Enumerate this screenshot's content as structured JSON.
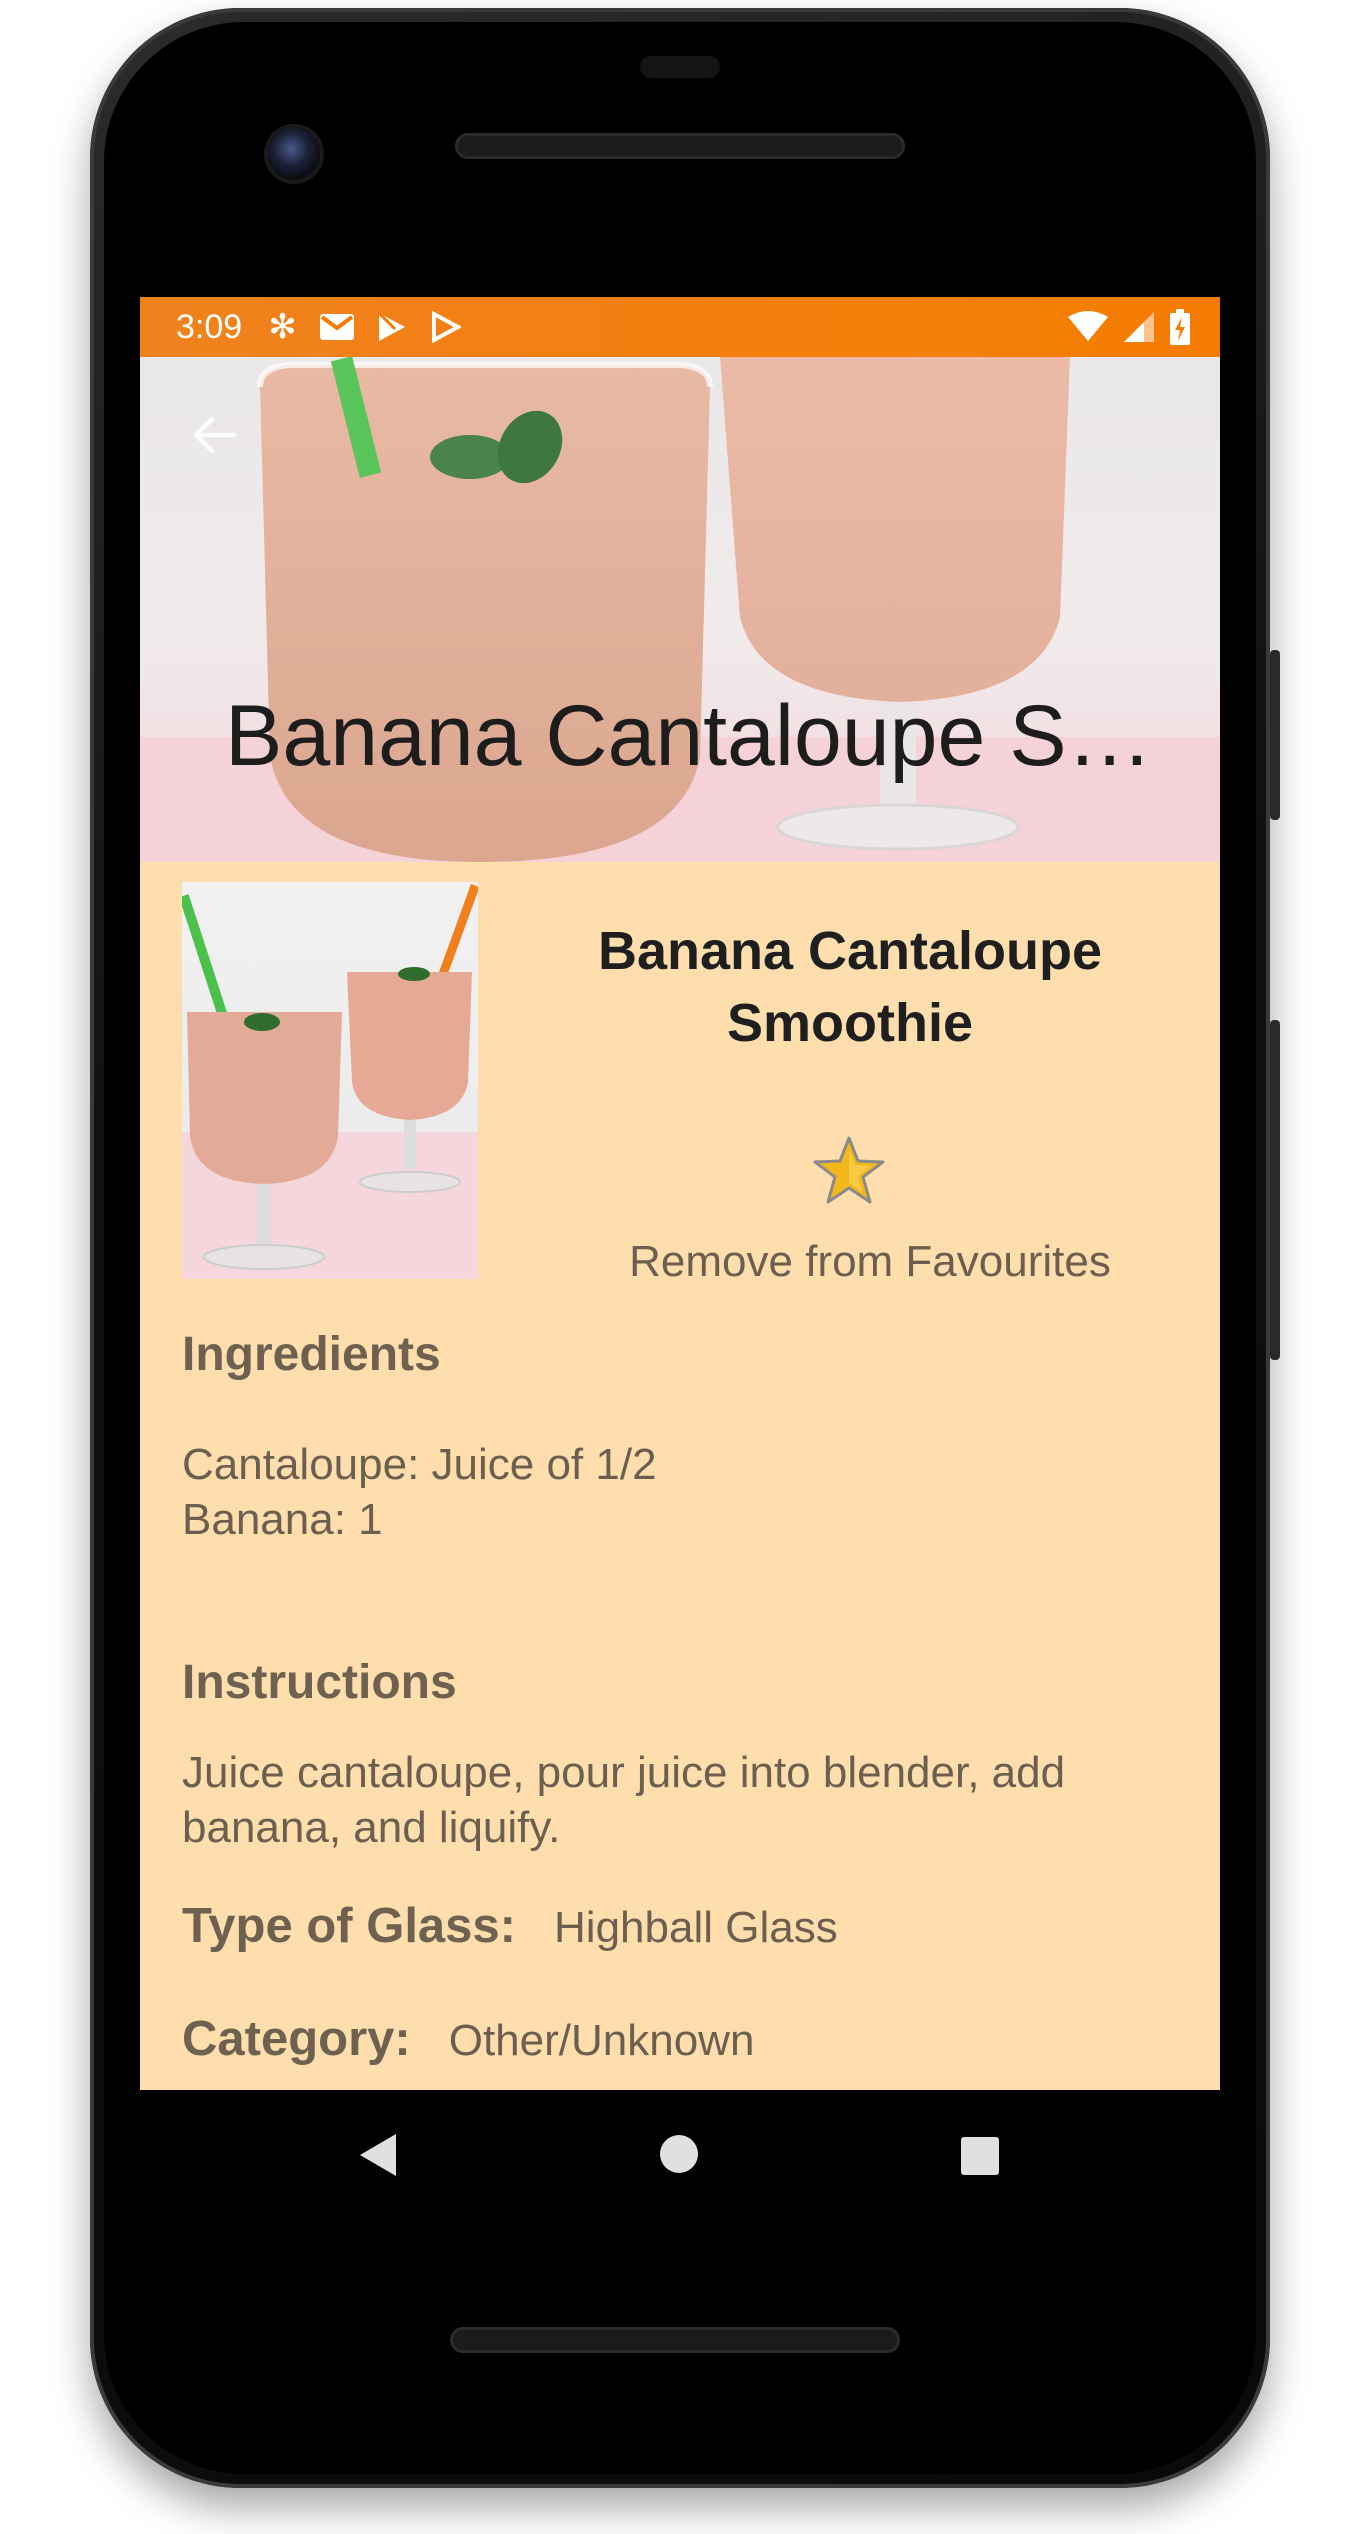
{
  "status_bar": {
    "time": "3:09",
    "left_icons": [
      "snowflake-icon",
      "mail-icon",
      "play-store-icon",
      "play-store-outline-icon"
    ],
    "right_icons": [
      "wifi-icon",
      "cellular-icon",
      "battery-charging-icon"
    ]
  },
  "toolbar": {
    "title": "Banana Cantaloupe Smoothie",
    "back_icon": "arrow-back-icon"
  },
  "drink": {
    "name": "Banana Cantaloupe Smoothie",
    "favourite_label": "Remove from Favourites",
    "favourite_icon": "star-icon"
  },
  "ingredients": {
    "heading": "Ingredients",
    "items": [
      "Cantaloupe: Juice of 1/2",
      "Banana: 1"
    ]
  },
  "instructions": {
    "heading": "Instructions",
    "text": "Juice cantaloupe, pour juice into blender, add banana, and liquify."
  },
  "glass": {
    "label": "Type of Glass:",
    "value": "Highball Glass"
  },
  "category": {
    "label": "Category:",
    "value": "Other/Unknown"
  },
  "nav": {
    "back_icon": "nav-back-icon",
    "home_icon": "nav-home-icon",
    "recents_icon": "nav-recents-icon"
  },
  "colors": {
    "status_bar": "#f57c00",
    "content_bg": "#ffdead",
    "text": "#6d5f4f"
  }
}
